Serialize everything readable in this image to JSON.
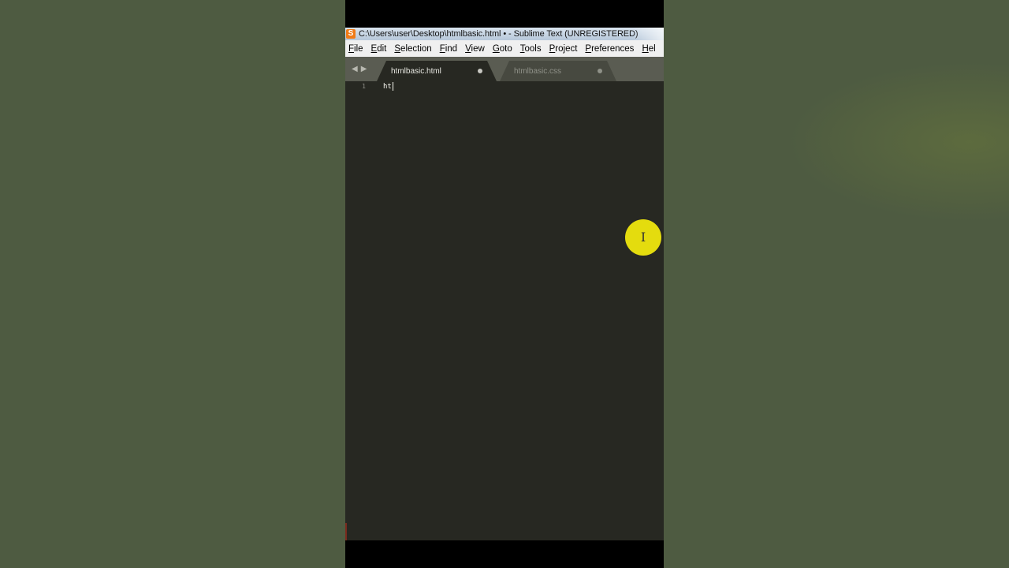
{
  "window": {
    "icon_glyph": "S",
    "title": "C:\\Users\\user\\Desktop\\htmlbasic.html • - Sublime Text (UNREGISTERED)"
  },
  "menu": {
    "items": [
      "File",
      "Edit",
      "Selection",
      "Find",
      "View",
      "Goto",
      "Tools",
      "Project",
      "Preferences",
      "Hel"
    ]
  },
  "nav": {
    "back_glyph": "◀",
    "forward_glyph": "▶"
  },
  "tabs": [
    {
      "label": "htmlbasic.html",
      "active": true
    },
    {
      "label": "htmlbasic.css",
      "active": false
    }
  ],
  "editor": {
    "lines": [
      {
        "number": "1",
        "code": "ht"
      }
    ]
  },
  "cursor": {
    "glyph": "I"
  },
  "colors": {
    "background": "#4e5b41",
    "editor_bg": "#272822",
    "tab_bar": "#5a5c52",
    "cursor_highlight": "#e4dc0e",
    "app_icon": "#f07b17"
  }
}
